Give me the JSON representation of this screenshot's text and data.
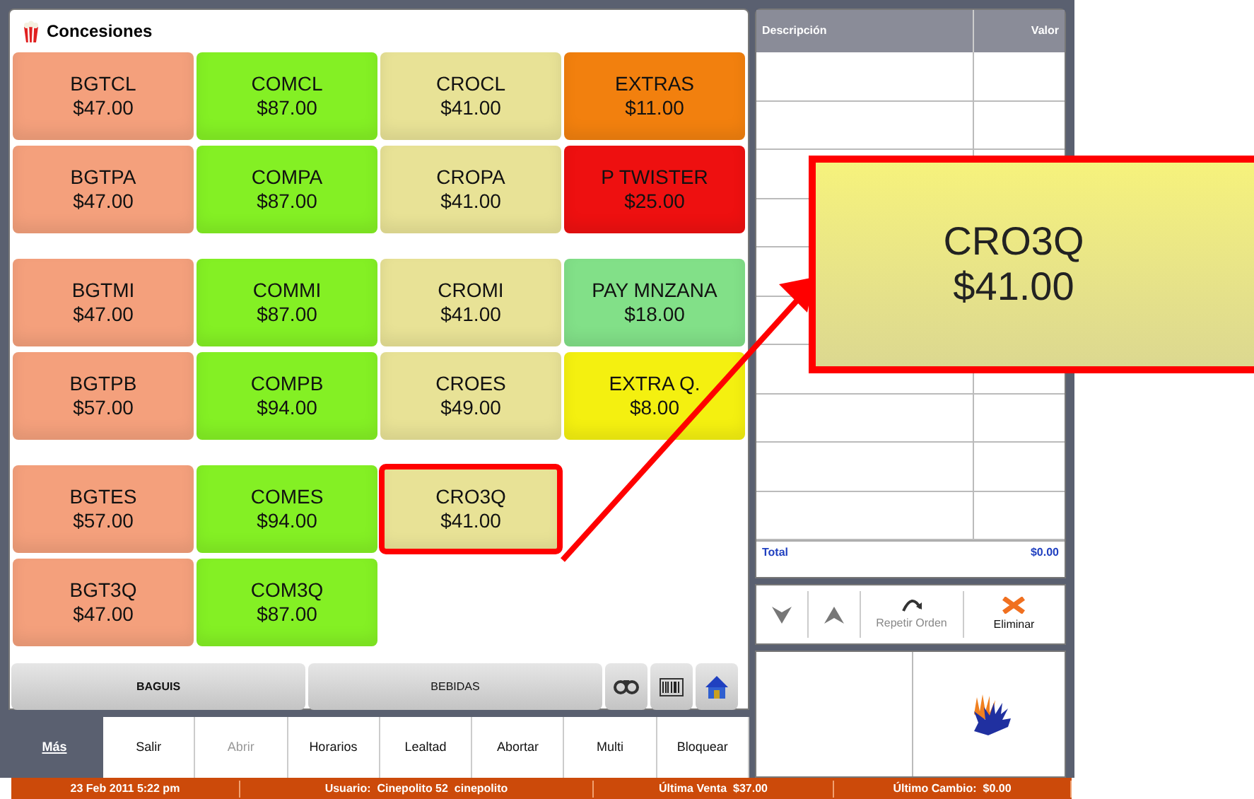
{
  "window": {
    "title": "Concesiones"
  },
  "product_groups": [
    {
      "rows": [
        [
          {
            "label": "BGTCL",
            "price": "$47.00",
            "color": "#f4a07c",
            "highlighted": false
          },
          {
            "label": "COMCL",
            "price": "$87.00",
            "color": "#84f024",
            "highlighted": false
          },
          {
            "label": "CROCL",
            "price": "$41.00",
            "color": "#e8e296",
            "highlighted": false
          },
          {
            "label": "EXTRAS",
            "price": "$11.00",
            "color": "#f2800e",
            "highlighted": false
          }
        ],
        [
          {
            "label": "BGTPA",
            "price": "$47.00",
            "color": "#f4a07c",
            "highlighted": false
          },
          {
            "label": "COMPA",
            "price": "$87.00",
            "color": "#84f024",
            "highlighted": false
          },
          {
            "label": "CROPA",
            "price": "$41.00",
            "color": "#e8e296",
            "highlighted": false
          },
          {
            "label": "P TWISTER",
            "price": "$25.00",
            "color": "#ee1010",
            "highlighted": false
          }
        ]
      ]
    },
    {
      "rows": [
        [
          {
            "label": "BGTMI",
            "price": "$47.00",
            "color": "#f4a07c",
            "highlighted": false
          },
          {
            "label": "COMMI",
            "price": "$87.00",
            "color": "#84f024",
            "highlighted": false
          },
          {
            "label": "CROMI",
            "price": "$41.00",
            "color": "#e8e296",
            "highlighted": false
          },
          {
            "label": "PAY MNZANA",
            "price": "$18.00",
            "color": "#82e088",
            "highlighted": false
          }
        ],
        [
          {
            "label": "BGTPB",
            "price": "$57.00",
            "color": "#f4a07c",
            "highlighted": false
          },
          {
            "label": "COMPB",
            "price": "$94.00",
            "color": "#84f024",
            "highlighted": false
          },
          {
            "label": "CROES",
            "price": "$49.00",
            "color": "#e8e296",
            "highlighted": false
          },
          {
            "label": "EXTRA Q.",
            "price": "$8.00",
            "color": "#f4f010",
            "highlighted": false
          }
        ]
      ]
    },
    {
      "rows": [
        [
          {
            "label": "BGTES",
            "price": "$57.00",
            "color": "#f4a07c",
            "highlighted": false
          },
          {
            "label": "COMES",
            "price": "$94.00",
            "color": "#84f024",
            "highlighted": false
          },
          {
            "label": "CRO3Q",
            "price": "$41.00",
            "color": "#e8e296",
            "highlighted": true
          }
        ],
        [
          {
            "label": "BGT3Q",
            "price": "$47.00",
            "color": "#f4a07c",
            "highlighted": false
          },
          {
            "label": "COM3Q",
            "price": "$87.00",
            "color": "#84f024",
            "highlighted": false
          }
        ]
      ]
    }
  ],
  "category_tabs": [
    {
      "label": "BAGUIS",
      "selected": true
    },
    {
      "label": "BEBIDAS",
      "selected": false
    }
  ],
  "menu": [
    {
      "label": "Más",
      "selected": true,
      "disabled": false
    },
    {
      "label": "Salir",
      "selected": false,
      "disabled": false
    },
    {
      "label": "Abrir",
      "selected": false,
      "disabled": true
    },
    {
      "label": "Horarios",
      "selected": false,
      "disabled": false
    },
    {
      "label": "Lealtad",
      "selected": false,
      "disabled": false
    },
    {
      "label": "Abortar",
      "selected": false,
      "disabled": false
    },
    {
      "label": "Multi",
      "selected": false,
      "disabled": false
    },
    {
      "label": "Bloquear",
      "selected": false,
      "disabled": false
    }
  ],
  "order_table": {
    "columns": [
      "Descripción",
      "Valor"
    ],
    "total_label": "Total",
    "total_value": "$0.00"
  },
  "order_actions": [
    {
      "kind": "down"
    },
    {
      "kind": "up"
    },
    {
      "kind": "repeat",
      "label": "Repetir Orden",
      "disabled": true
    },
    {
      "kind": "delete",
      "label": "Eliminar",
      "disabled": false
    }
  ],
  "status_bar": [
    "23 Feb 2011 5:22 pm",
    "Usuario:  Cinepolito 52  cinepolito",
    "Última Venta  $37.00",
    "Último Cambio:  $0.00"
  ],
  "callout": {
    "label": "CRO3Q",
    "price": "$41.00"
  }
}
